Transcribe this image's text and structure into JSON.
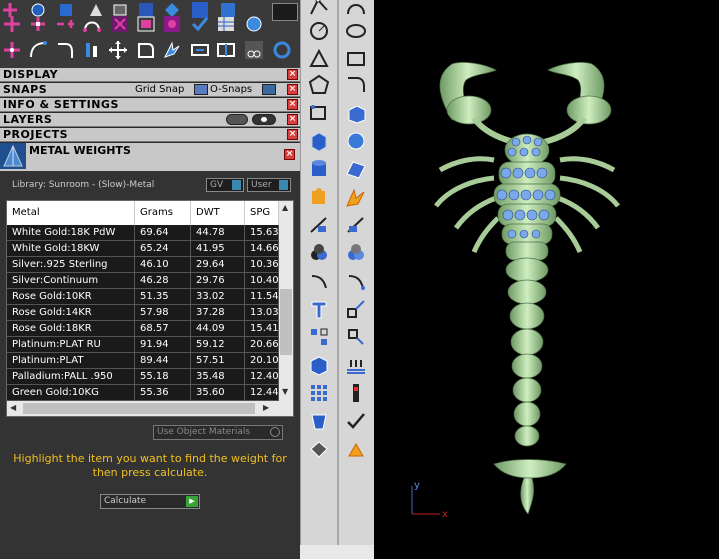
{
  "panels": {
    "display": "DISPLAY",
    "snaps": "SNAPS",
    "grid_snap": "Grid Snap",
    "o_snaps": "O-Snaps",
    "info_settings": "INFO & SETTINGS",
    "layers": "LAYERS",
    "projects": "PROJECTS"
  },
  "metal_weights": {
    "title": "METAL WEIGHTS",
    "library": "Library: Sunroom - (Slow)-Metal",
    "gv_label": "GV",
    "user_label": "User",
    "columns": [
      "Metal",
      "Grams",
      "DWT",
      "SPG"
    ],
    "rows": [
      [
        "White Gold:18K PdW",
        "69.64",
        "44.78",
        "15.63"
      ],
      [
        "White Gold:18KW",
        "65.24",
        "41.95",
        "14.66"
      ],
      [
        "Silver:.925 Sterling",
        "46.10",
        "29.64",
        "10.36"
      ],
      [
        "Silver:Continuum",
        "46.28",
        "29.76",
        "10.40"
      ],
      [
        "Rose Gold:10KR",
        "51.35",
        "33.02",
        "11.54"
      ],
      [
        "Rose Gold:14KR",
        "57.98",
        "37.28",
        "13.03"
      ],
      [
        "Rose Gold:18KR",
        "68.57",
        "44.09",
        "15.41"
      ],
      [
        "Platinum:PLAT RU",
        "91.94",
        "59.12",
        "20.66"
      ],
      [
        "Platinum:PLAT",
        "89.44",
        "57.51",
        "20.10"
      ],
      [
        "Palladium:PALL .950",
        "55.18",
        "35.48",
        "12.40"
      ],
      [
        "Green Gold:10KG",
        "55.36",
        "35.60",
        "12.44"
      ]
    ],
    "use_object_materials": "Use Object Materials",
    "hint": "Highlight the item you want to find the weight for then press calculate.",
    "calculate": "Calculate"
  },
  "viewport": {
    "axis_y": "y",
    "axis_x": "x"
  },
  "colors": {
    "hint_text": "#f0c020",
    "model": "#b8e0a8",
    "gems": "#7aa8e8"
  }
}
